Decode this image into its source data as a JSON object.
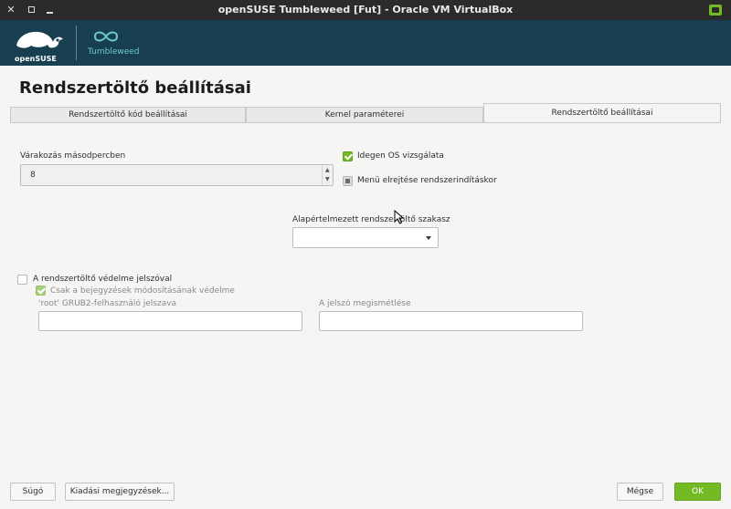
{
  "window": {
    "title": "openSUSE Tumbleweed [Fut] - Oracle VM VirtualBox",
    "close_glyph": "✕"
  },
  "banner": {
    "opensuse_logo_text": "openSUSE",
    "tumbleweed_text": "Tumbleweed"
  },
  "page": {
    "heading": "Rendszertöltő beállításai"
  },
  "tabs": [
    {
      "label": "Rendszertöltő kód beállításai",
      "active": false
    },
    {
      "label": "Kernel paraméterei",
      "active": false
    },
    {
      "label": "Rendszertöltő beállításai",
      "active": true
    }
  ],
  "options": {
    "timeout_label": "Várakozás másodpercben",
    "timeout_value": "8",
    "probe_os_label": "Idegen OS vizsgálata",
    "probe_os_checked": true,
    "hide_menu_label": "Menü elrejtése rendszerindításkor",
    "default_section_label": "Alapértelmezett rendszertöltő szakasz",
    "default_section_value": ""
  },
  "password": {
    "protect_label": "A rendszertöltő védelme jelszóval",
    "protect_checked": false,
    "restrict_label": "Csak a bejegyzések módosításának védelme",
    "restrict_checked": true,
    "root_pw_label": "'root' GRUB2-felhasználó jelszava",
    "root_pw_value": "",
    "repeat_pw_label": "A jelszó megismétlése",
    "repeat_pw_value": ""
  },
  "buttons": {
    "help": "Súgó",
    "release_notes": "Kiadási megjegyzések...",
    "cancel": "Mégse",
    "ok": "OK"
  },
  "colors": {
    "accent": "#73ba25",
    "banner": "#173f4f",
    "titlebar": "#2b2b2b"
  }
}
